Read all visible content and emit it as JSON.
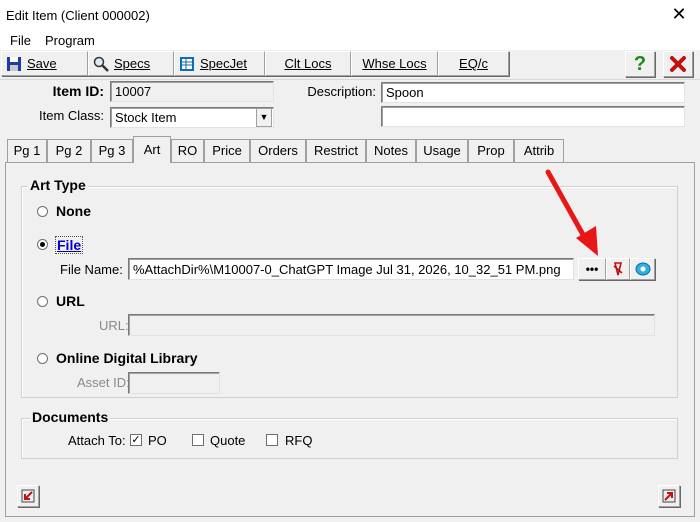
{
  "window": {
    "title": "Edit Item (Client 000002)",
    "close_glyph": "✕"
  },
  "menu": {
    "items": [
      "File",
      "Program"
    ]
  },
  "toolbar": {
    "buttons": [
      {
        "label": "Save",
        "icon": "floppy-disk-icon"
      },
      {
        "label": "Specs",
        "icon": "magnifier-icon"
      },
      {
        "label": "SpecJet",
        "icon": "spreadsheet-icon"
      },
      {
        "label": "Clt Locs",
        "icon": ""
      },
      {
        "label": "Whse Locs",
        "icon": ""
      },
      {
        "label": "EQ/c",
        "icon": ""
      }
    ],
    "help_glyph": "?",
    "cancel_icon": "red-x-icon"
  },
  "header": {
    "item_id_label": "Item ID:",
    "item_id_value": "10007",
    "item_class_label": "Item Class:",
    "item_class_value": "Stock Item",
    "description_label": "Description:",
    "description_value": "Spoon",
    "description_line2": ""
  },
  "tabs": [
    "Pg 1",
    "Pg 2",
    "Pg 3",
    "Art",
    "RO",
    "Price",
    "Orders",
    "Restrict",
    "Notes",
    "Usage",
    "Prop",
    "Attrib"
  ],
  "active_tab": "Art",
  "art": {
    "group_label": "Art Type",
    "options": {
      "none": "None",
      "file": "File",
      "url": "URL",
      "library": "Online Digital Library"
    },
    "selected": "file",
    "file_name_label": "File Name:",
    "file_name_value": "%AttachDir%\\M10007-0_ChatGPT Image Jul 31, 2026, 10_32_51 PM.png",
    "browse_label": "•••",
    "url_label": "URL:",
    "url_value": "",
    "asset_id_label": "Asset ID:",
    "asset_id_value": ""
  },
  "documents": {
    "group_label": "Documents",
    "attach_to_label": "Attach To:",
    "checks": [
      {
        "label": "PO",
        "checked": true
      },
      {
        "label": "Quote",
        "checked": false
      },
      {
        "label": "RFQ",
        "checked": false
      }
    ]
  },
  "colors": {
    "accent_red": "#e81616",
    "file_label_blue": "#0000cc",
    "help_green": "#1a8a1a"
  }
}
